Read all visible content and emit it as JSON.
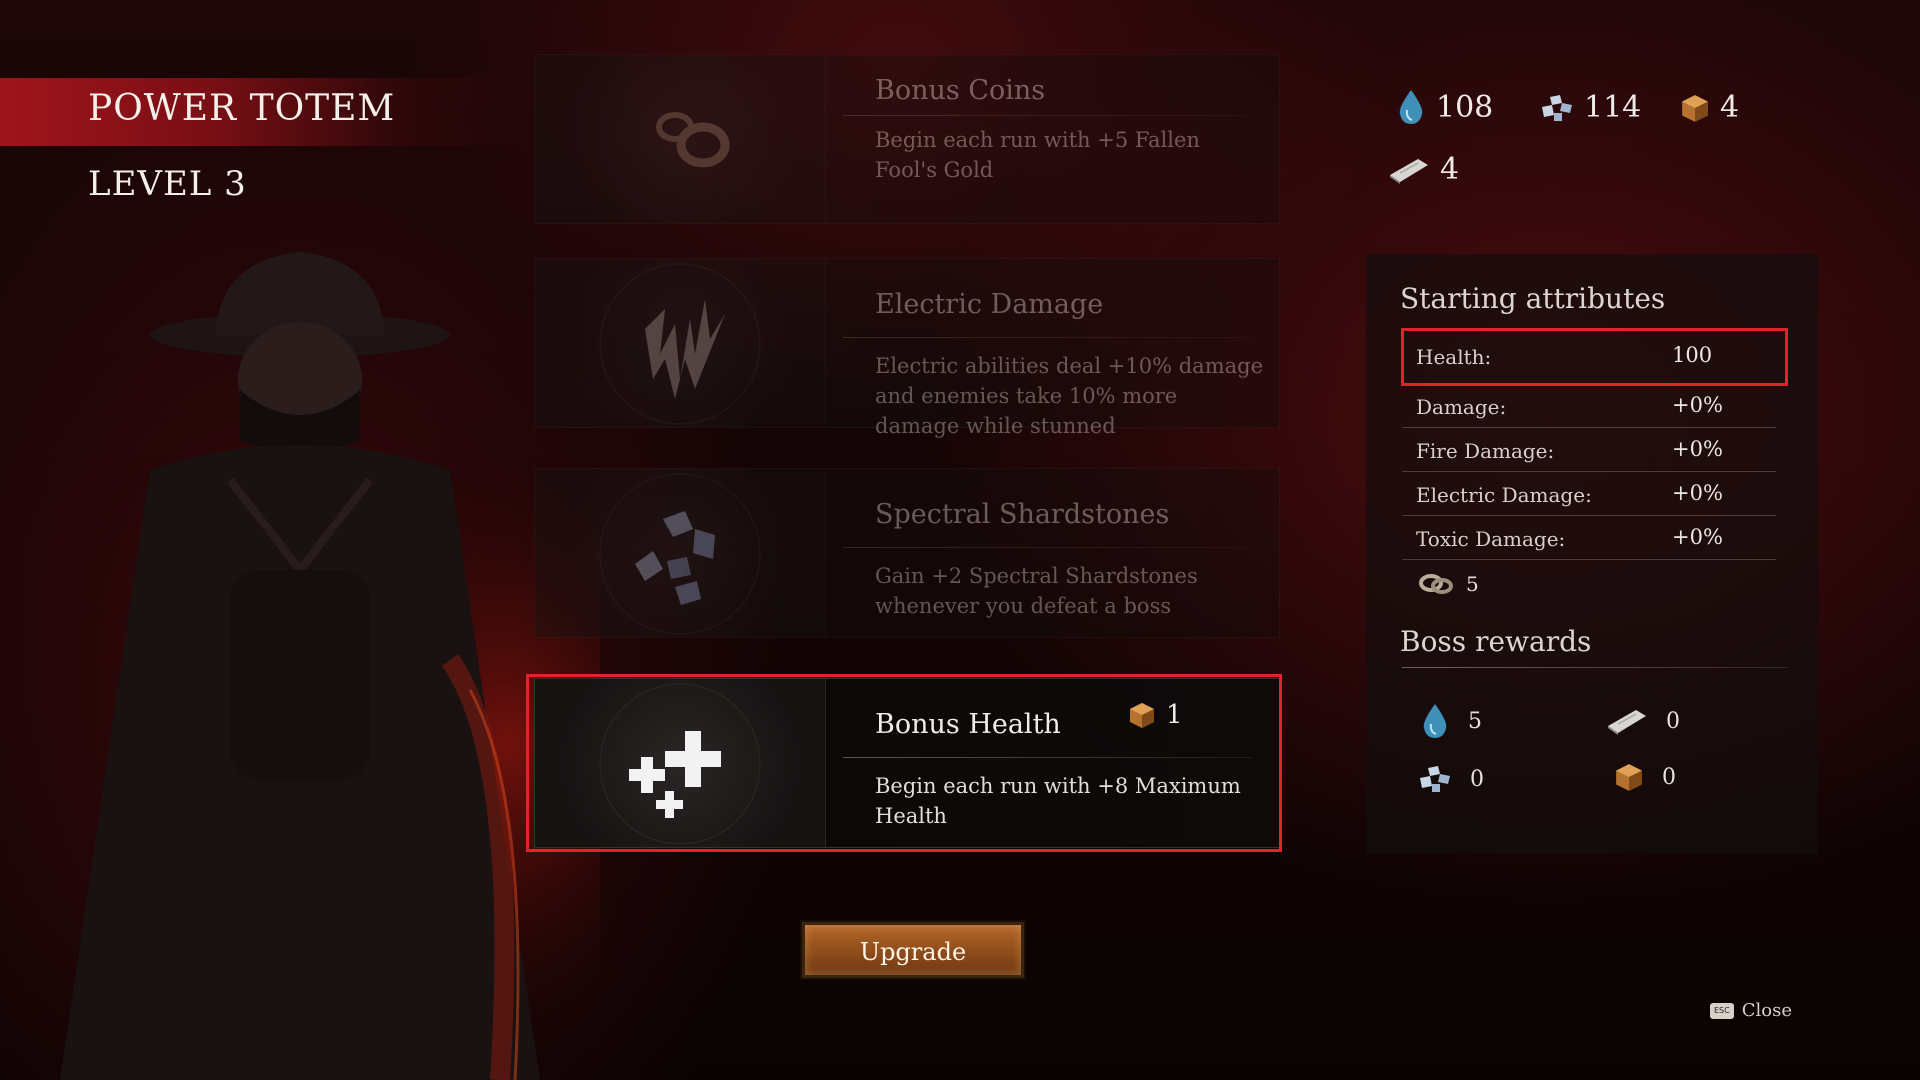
{
  "header": {
    "title": "POWER TOTEM",
    "level": "LEVEL 3"
  },
  "currencies": {
    "water": {
      "icon": "water-drop-icon",
      "value": "108"
    },
    "shards": {
      "icon": "shardstone-icon",
      "value": "114"
    },
    "chest": {
      "icon": "treasure-box-icon",
      "value": "4"
    },
    "scroll": {
      "icon": "scroll-icon",
      "value": "4"
    }
  },
  "perks": [
    {
      "name": "Bonus Coins",
      "desc": "Begin each run with +5 Fallen Fool's Gold",
      "icon": "coin-icon",
      "state": "dimmed"
    },
    {
      "name": "Electric Damage",
      "desc": "Electric abilities deal +10% damage and enemies take 10% more damage while stunned",
      "icon": "lightning-icon",
      "state": "dimmed"
    },
    {
      "name": "Spectral Shardstones",
      "desc": "Gain +2 Spectral Shardstones whenever you defeat a boss",
      "icon": "shardstone-icon",
      "state": "dimmed"
    },
    {
      "name": "Bonus Health",
      "desc": "Begin each run with +8 Maximum Health",
      "icon": "health-cross-icon",
      "state": "selected",
      "cost": "1",
      "cost_icon": "treasure-box-icon"
    }
  ],
  "upgrade_label": "Upgrade",
  "attributes": {
    "heading": "Starting attributes",
    "rows": [
      {
        "label": "Health:",
        "value": "100"
      },
      {
        "label": "Damage:",
        "value": "+0%"
      },
      {
        "label": "Fire Damage:",
        "value": "+0%"
      },
      {
        "label": "Electric Damage:",
        "value": "+0%"
      },
      {
        "label": "Toxic Damage:",
        "value": "+0%"
      }
    ],
    "coins": {
      "icon": "coin-icon",
      "value": "5"
    }
  },
  "boss_rewards": {
    "heading": "Boss rewards",
    "items": [
      {
        "icon": "water-drop-icon",
        "value": "5"
      },
      {
        "icon": "scroll-icon",
        "value": "0"
      },
      {
        "icon": "shardstone-icon",
        "value": "0"
      },
      {
        "icon": "treasure-box-icon",
        "value": "0"
      }
    ]
  },
  "close": {
    "key": "ESC",
    "label": "Close"
  },
  "colors": {
    "highlight": "#e3222c",
    "title_band": "#a0141b",
    "button": "#b4672a"
  }
}
